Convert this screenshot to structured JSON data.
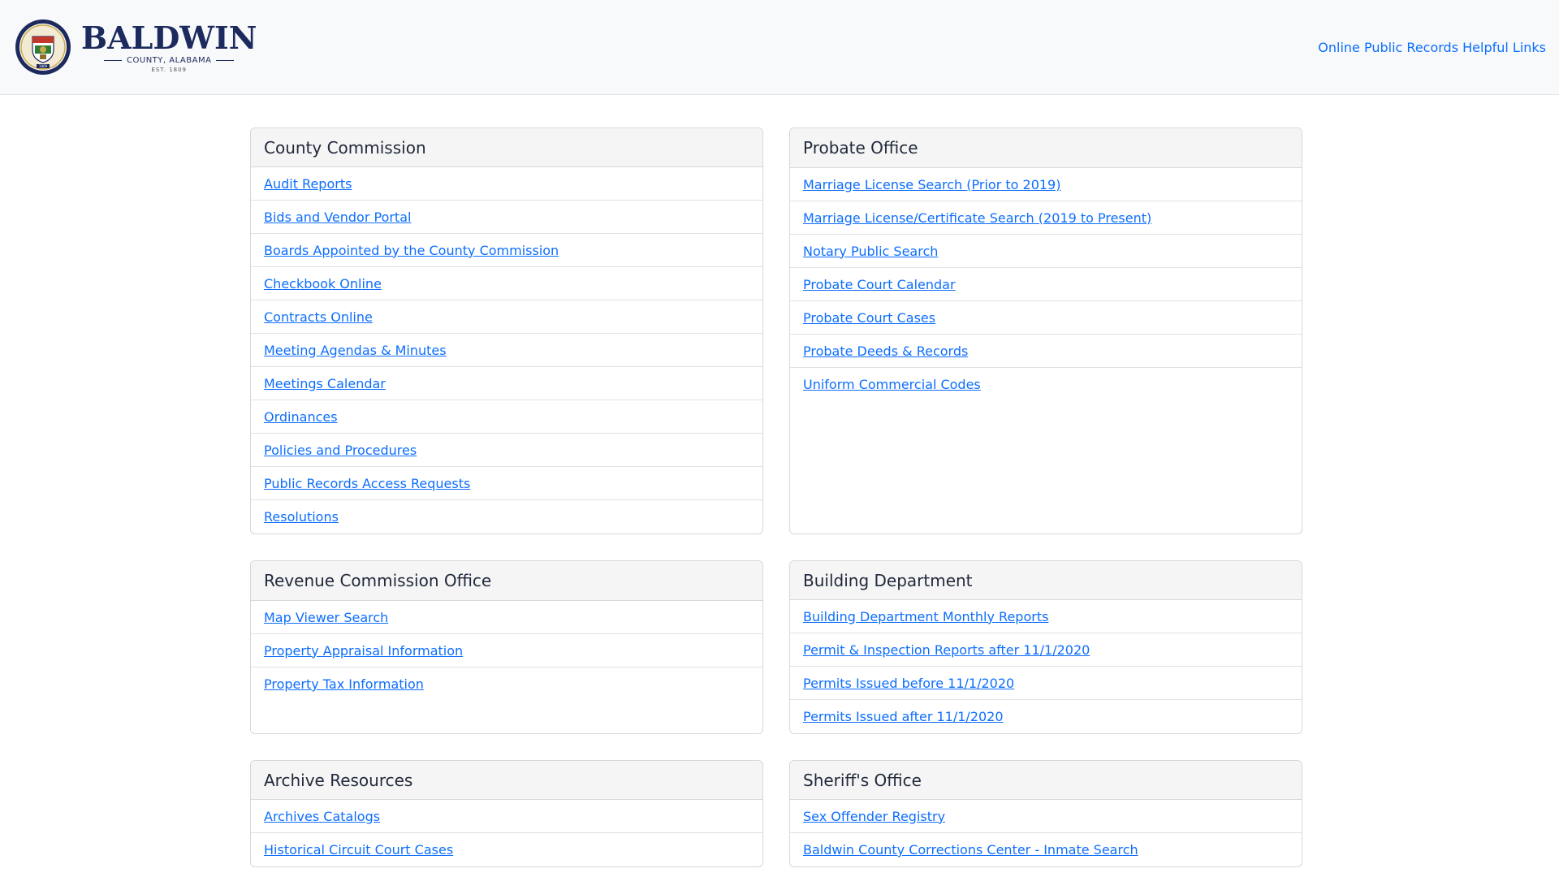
{
  "header": {
    "brand_name": "BALDWIN",
    "brand_sub": "COUNTY, ALABAMA",
    "brand_est": "EST. 1809",
    "seal_year": "1809",
    "nav_link": "Online Public Records Helpful Links"
  },
  "colors": {
    "link": "#0d6efd",
    "brand_navy": "#1d2a5e",
    "navbar_bg": "#f8f9fa",
    "card_header_bg": "#f5f5f5"
  },
  "cards": {
    "county_commission": {
      "title": "County Commission",
      "links": [
        "Audit Reports",
        "Bids and Vendor Portal",
        "Boards Appointed by the County Commission",
        "Checkbook Online",
        "Contracts Online",
        "Meeting Agendas & Minutes",
        "Meetings Calendar",
        "Ordinances",
        "Policies and Procedures",
        "Public Records Access Requests",
        "Resolutions"
      ]
    },
    "probate_office": {
      "title": "Probate Office",
      "links": [
        "Marriage License Search (Prior to 2019)",
        "Marriage License/Certificate Search (2019 to Present)",
        "Notary Public Search",
        "Probate Court Calendar",
        "Probate Court Cases",
        "Probate Deeds & Records",
        "Uniform Commercial Codes"
      ]
    },
    "revenue_commission": {
      "title": "Revenue Commission Office",
      "links": [
        "Map Viewer Search",
        "Property Appraisal Information",
        "Property Tax Information"
      ]
    },
    "building_department": {
      "title": "Building Department",
      "links": [
        "Building Department Monthly Reports",
        "Permit & Inspection Reports after 11/1/2020",
        "Permits Issued before 11/1/2020",
        "Permits Issued after 11/1/2020"
      ]
    },
    "archive_resources": {
      "title": "Archive Resources",
      "links": [
        "Archives Catalogs",
        "Historical Circuit Court Cases"
      ]
    },
    "sheriffs_office": {
      "title": "Sheriff's Office",
      "links": [
        "Sex Offender Registry",
        "Baldwin County Corrections Center - Inmate Search"
      ]
    }
  }
}
